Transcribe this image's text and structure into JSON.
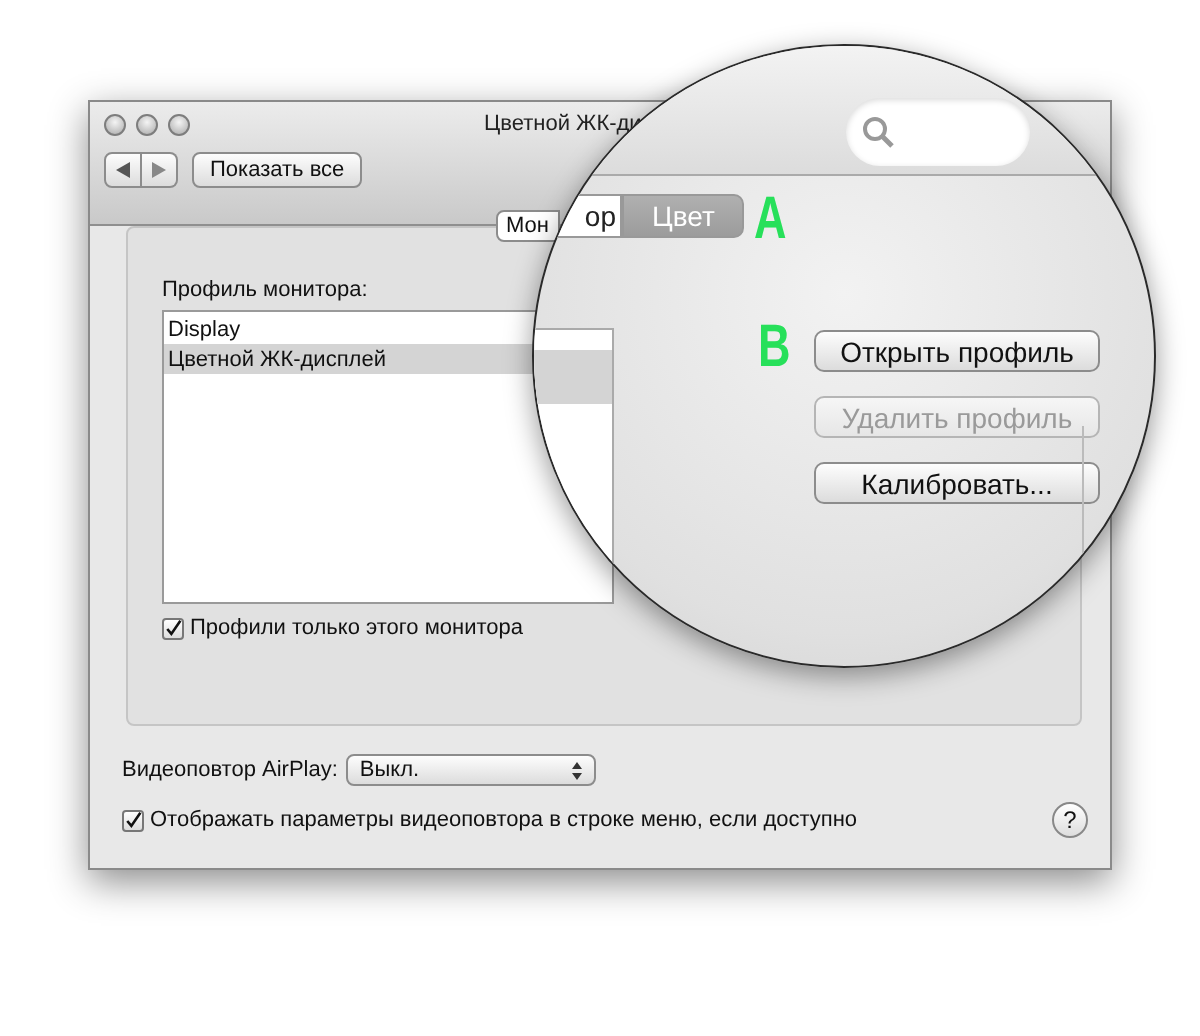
{
  "window": {
    "title": "Цветной ЖК-ди",
    "show_all_button": "Показать все",
    "tabs": [
      {
        "label": "Мон",
        "selected": false
      }
    ],
    "profile_label": "Профиль монитора:",
    "profiles": [
      {
        "name": "Display",
        "selected": false
      },
      {
        "name": "Цветной ЖК-дисплей",
        "selected": true
      }
    ],
    "this_monitor_only": {
      "label": "Профили только этого монитора",
      "checked": true
    },
    "airplay": {
      "label": "Видеоповтор AirPlay:",
      "value": "Выкл."
    },
    "show_in_menu": {
      "label": "Отображать параметры видеоповтора в строке меню, если доступно",
      "checked": true
    },
    "help_button": "?"
  },
  "magnifier": {
    "tabs": [
      {
        "label": "ор",
        "selected": false
      },
      {
        "label": "Цвет",
        "selected": true
      }
    ],
    "markers": [
      "A",
      "B"
    ],
    "buttons": [
      {
        "label": "Открыть профиль",
        "disabled": false
      },
      {
        "label": "Удалить профиль",
        "disabled": true
      },
      {
        "label": "Калибровать...",
        "disabled": false
      }
    ]
  }
}
